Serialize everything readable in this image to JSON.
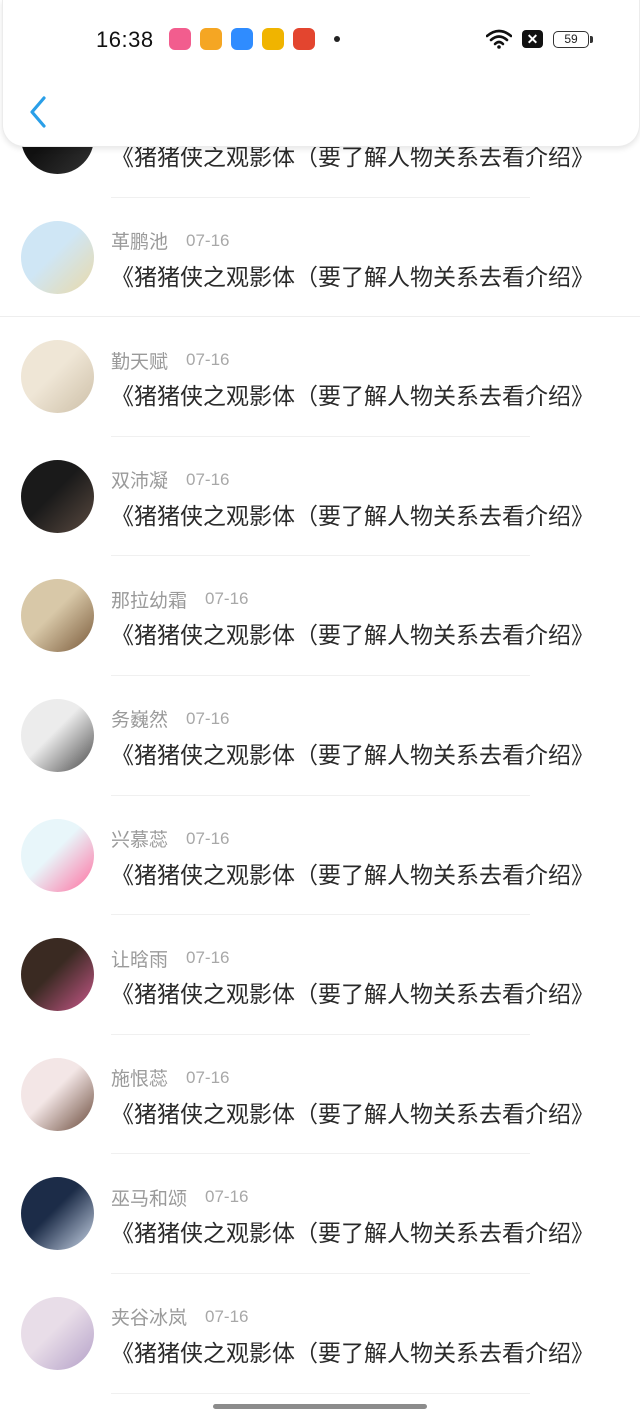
{
  "status_bar": {
    "time": "16:38",
    "battery": "59",
    "apps": [
      {
        "icon": "bilibili-app-icon",
        "color": "#f25d8e"
      },
      {
        "icon": "tencent-video-app-icon",
        "color": "#f5a623"
      },
      {
        "icon": "play-app-icon",
        "color": "#2f8cff"
      },
      {
        "icon": "weibo-app-icon",
        "color": "#f0b400"
      },
      {
        "icon": "food-app-icon",
        "color": "#e3452f"
      }
    ]
  },
  "header": {
    "back_icon": "chevron-left-icon",
    "accent": "#2a9fe8"
  },
  "messages": [
    {
      "name": "",
      "date": "",
      "text": "《猪猪侠之观影体（要了解人物关系去看介绍》",
      "avatar_colors": [
        "#111111",
        "#333333"
      ]
    },
    {
      "name": "革鹏池",
      "date": "07-16",
      "text": "《猪猪侠之观影体（要了解人物关系去看介绍》",
      "avatar_colors": [
        "#cfe6f5",
        "#e9d9a8"
      ]
    },
    {
      "name": "勤天赋",
      "date": "07-16",
      "text": "《猪猪侠之观影体（要了解人物关系去看介绍》",
      "avatar_colors": [
        "#efe6d6",
        "#cdbfa7"
      ]
    },
    {
      "name": "双沛凝",
      "date": "07-16",
      "text": "《猪猪侠之观影体（要了解人物关系去看介绍》",
      "avatar_colors": [
        "#1a1a1a",
        "#5a4a40"
      ]
    },
    {
      "name": "那拉幼霜",
      "date": "07-16",
      "text": "《猪猪侠之观影体（要了解人物关系去看介绍》",
      "avatar_colors": [
        "#d8c8a8",
        "#7a5a3a"
      ]
    },
    {
      "name": "务巍然",
      "date": "07-16",
      "text": "《猪猪侠之观影体（要了解人物关系去看介绍》",
      "avatar_colors": [
        "#ececec",
        "#4a4a4a"
      ]
    },
    {
      "name": "兴慕蕊",
      "date": "07-16",
      "text": "《猪猪侠之观影体（要了解人物关系去看介绍》",
      "avatar_colors": [
        "#e8f6fa",
        "#ff6fa0"
      ]
    },
    {
      "name": "让晗雨",
      "date": "07-16",
      "text": "《猪猪侠之观影体（要了解人物关系去看介绍》",
      "avatar_colors": [
        "#3a2a22",
        "#c9588a"
      ]
    },
    {
      "name": "施恨蕊",
      "date": "07-16",
      "text": "《猪猪侠之观影体（要了解人物关系去看介绍》",
      "avatar_colors": [
        "#f3e6e6",
        "#6a4a3a"
      ]
    },
    {
      "name": "巫马和颂",
      "date": "07-16",
      "text": "《猪猪侠之观影体（要了解人物关系去看介绍》",
      "avatar_colors": [
        "#1c2c48",
        "#c8d4e6"
      ]
    },
    {
      "name": "夹谷冰岚",
      "date": "07-16",
      "text": "《猪猪侠之观影体（要了解人物关系去看介绍》",
      "avatar_colors": [
        "#e8dde8",
        "#b4a0c8"
      ]
    }
  ]
}
